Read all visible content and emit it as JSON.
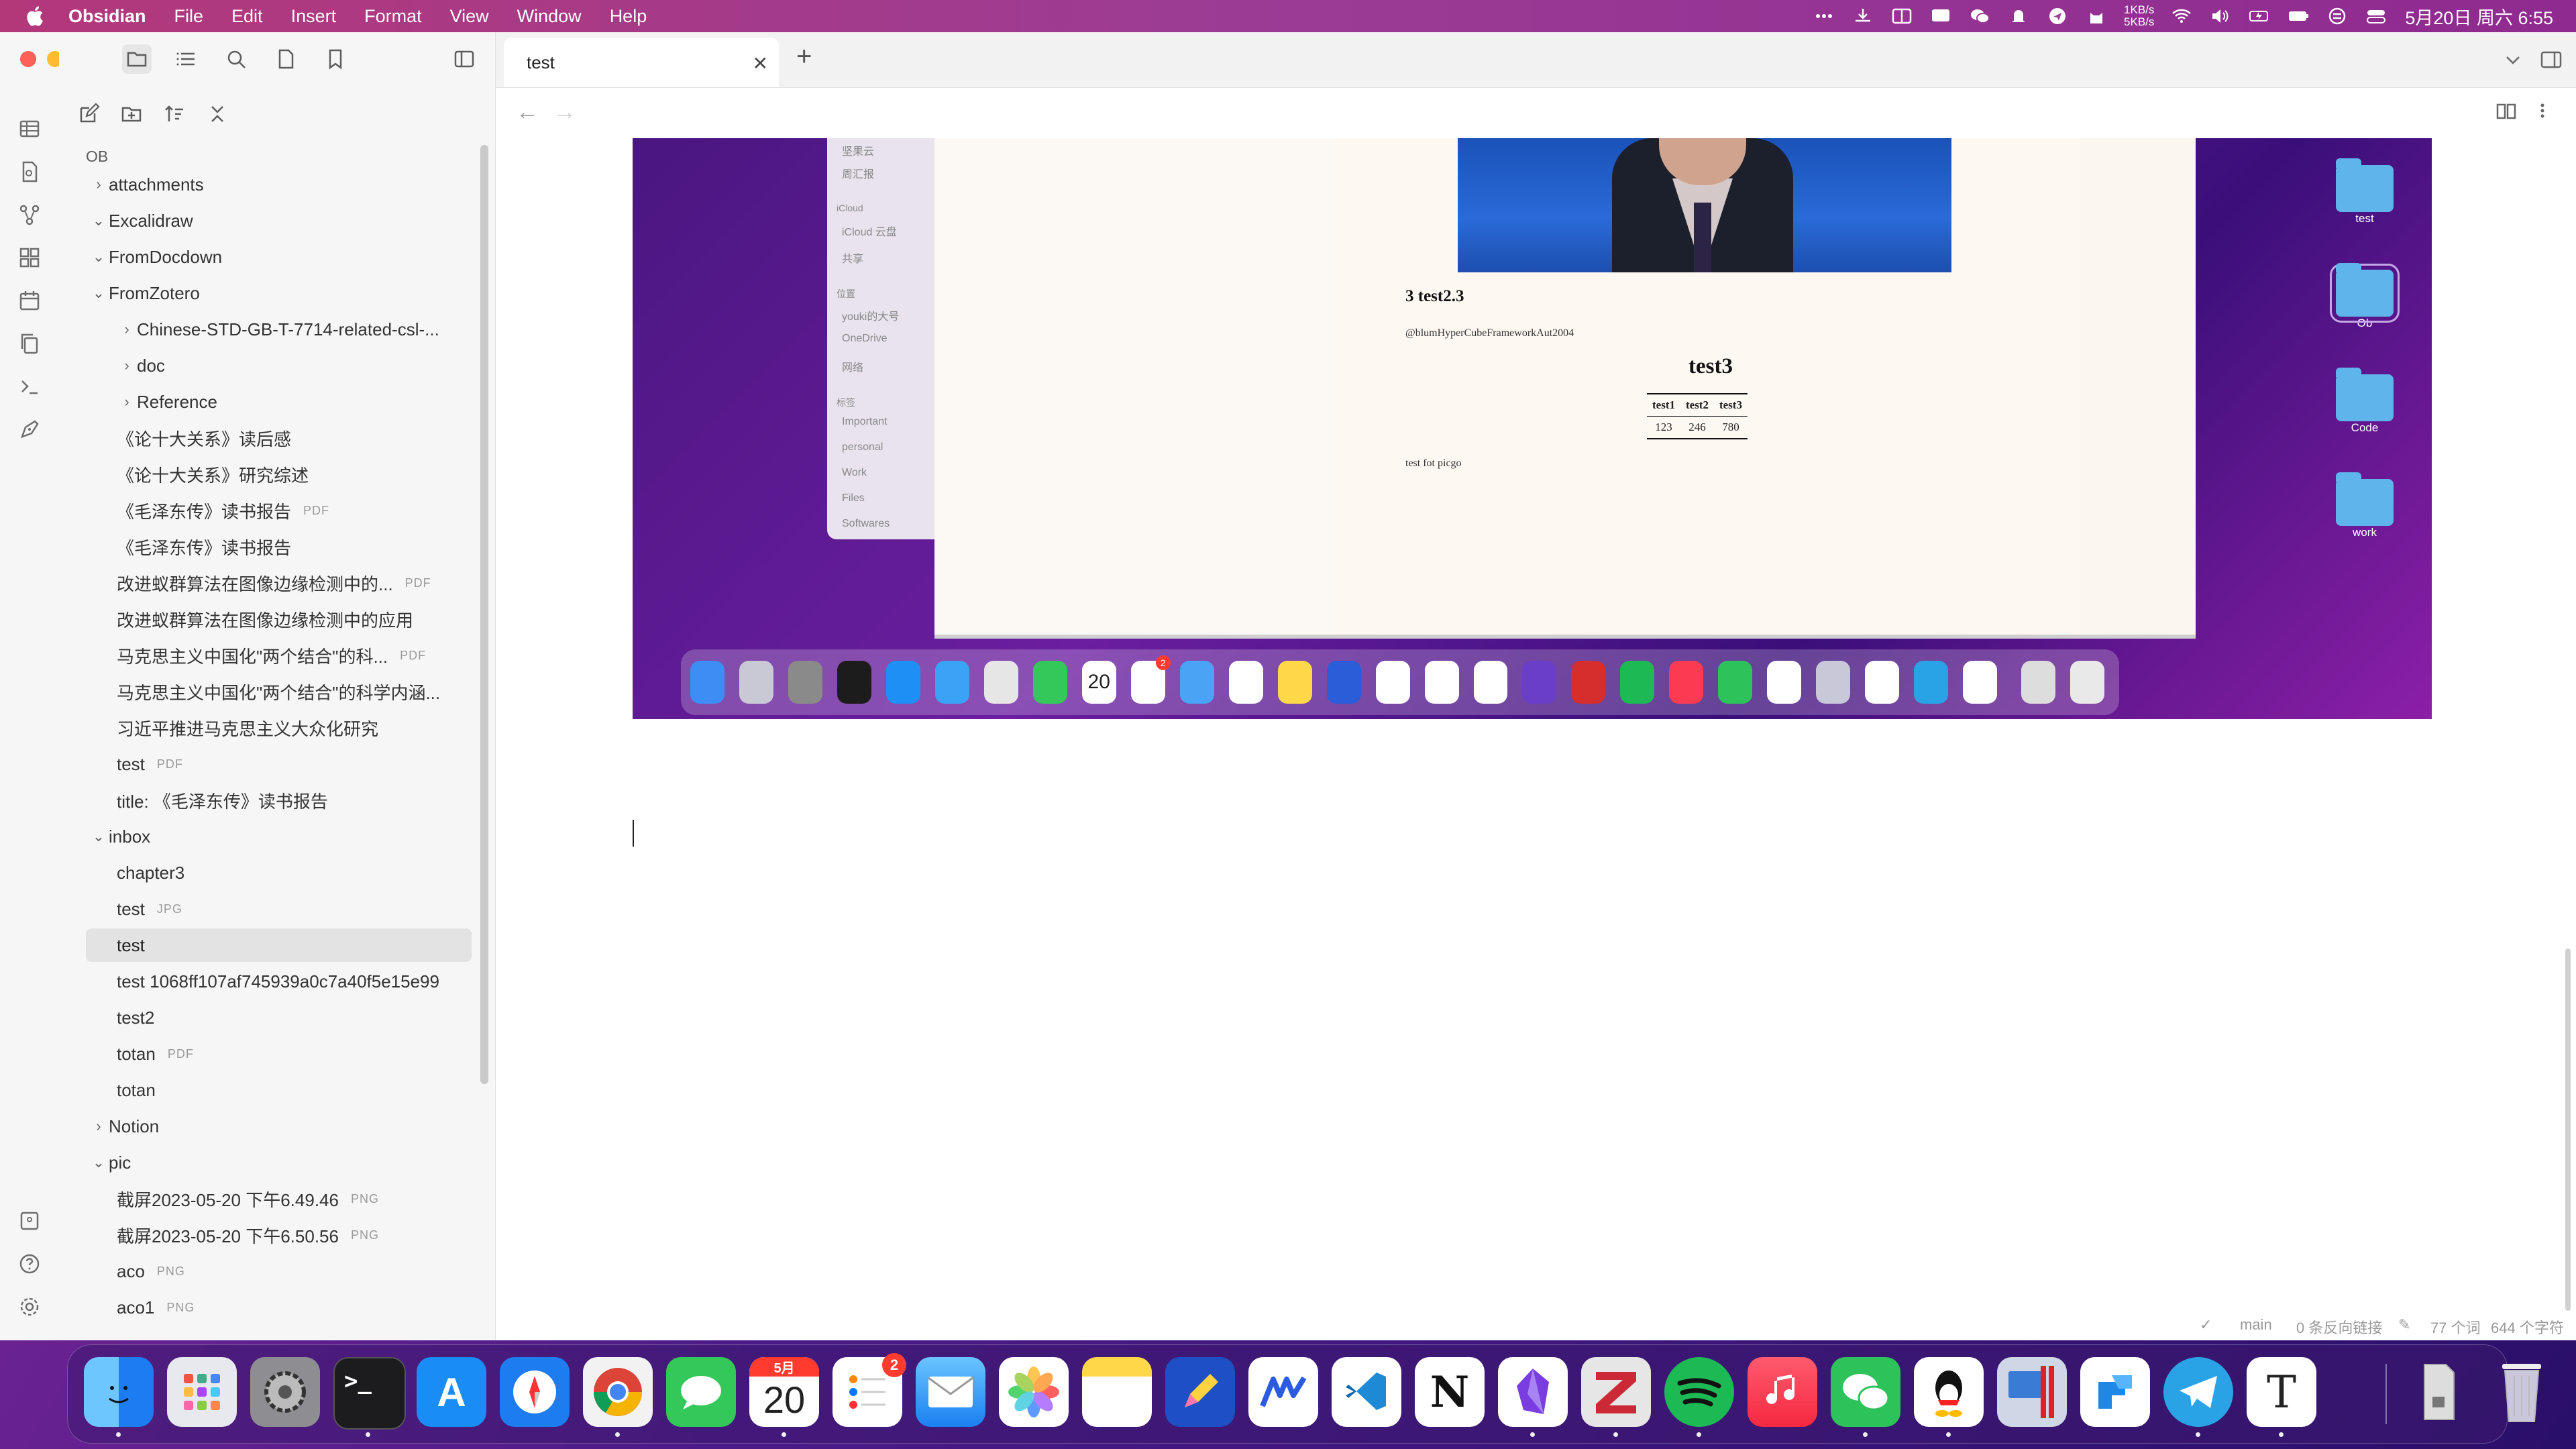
{
  "menubar": {
    "app_name": "Obsidian",
    "menus": [
      "File",
      "Edit",
      "Insert",
      "Format",
      "View",
      "Window",
      "Help"
    ],
    "net_up": "1KB/s",
    "net_down": "5KB/s",
    "clock": "5月20日 周六  6:55"
  },
  "sidebar": {
    "vault_name": "OB",
    "tree": [
      {
        "label": "attachments",
        "chev": "›",
        "depth": 0
      },
      {
        "label": "Excalidraw",
        "chev": "⌄",
        "depth": 0
      },
      {
        "label": "FromDocdown",
        "chev": "⌄",
        "depth": 0
      },
      {
        "label": "FromZotero",
        "chev": "⌄",
        "depth": 0
      },
      {
        "label": "Chinese-STD-GB-T-7714-related-csl-...",
        "chev": "›",
        "depth": 1
      },
      {
        "label": "doc",
        "chev": "›",
        "depth": 1
      },
      {
        "label": "Reference",
        "chev": "›",
        "depth": 1
      },
      {
        "label": "《论十大关系》读后感",
        "depth": 1
      },
      {
        "label": "《论十大关系》研究综述",
        "depth": 1
      },
      {
        "label": "《毛泽东传》读书报告",
        "ext": "PDF",
        "depth": 1
      },
      {
        "label": "《毛泽东传》读书报告",
        "depth": 1
      },
      {
        "label": "改进蚁群算法在图像边缘检测中的...",
        "ext": "PDF",
        "depth": 1
      },
      {
        "label": "改进蚁群算法在图像边缘检测中的应用",
        "depth": 1
      },
      {
        "label": "马克思主义中国化\"两个结合\"的科...",
        "ext": "PDF",
        "depth": 1
      },
      {
        "label": "马克思主义中国化\"两个结合\"的科学内涵...",
        "depth": 1
      },
      {
        "label": "习近平推进马克思主义大众化研究",
        "depth": 1
      },
      {
        "label": "test",
        "ext": "PDF",
        "depth": 1
      },
      {
        "label": "title: 《毛泽东传》读书报告",
        "depth": 1
      },
      {
        "label": "inbox",
        "chev": "⌄",
        "depth": 0
      },
      {
        "label": "chapter3",
        "depth": 1
      },
      {
        "label": "test",
        "ext": "JPG",
        "depth": 1
      },
      {
        "label": "test",
        "depth": 1,
        "selected": true
      },
      {
        "label": "test 1068ff107af745939a0c7a40f5e15e99",
        "depth": 1
      },
      {
        "label": "test2",
        "depth": 1
      },
      {
        "label": "totan",
        "ext": "PDF",
        "depth": 1
      },
      {
        "label": "totan",
        "depth": 1
      },
      {
        "label": "Notion",
        "chev": "›",
        "depth": 0
      },
      {
        "label": "pic",
        "chev": "⌄",
        "depth": 0
      },
      {
        "label": "截屏2023-05-20 下午6.49.46",
        "ext": "PNG",
        "depth": 1
      },
      {
        "label": "截屏2023-05-20 下午6.50.56",
        "ext": "PNG",
        "depth": 1
      },
      {
        "label": "aco",
        "ext": "PNG",
        "depth": 1
      },
      {
        "label": "aco1",
        "ext": "PNG",
        "depth": 1
      }
    ]
  },
  "tab": {
    "title": "test"
  },
  "embed": {
    "finder_sidebar": [
      "坚果云",
      "周汇报",
      "iCloud",
      "iCloud 云盘",
      "共享",
      "位置",
      "youki的大号",
      "OneDrive",
      "网络",
      "标签",
      "Important",
      "personal",
      "Work",
      "Files",
      "Softwares"
    ],
    "doc": {
      "section_heading": "3    test2.3",
      "citation": "@blumHyperCubeFrameworkAut2004",
      "heading": "test3",
      "table_headers": [
        "test1",
        "test2",
        "test3"
      ],
      "table_values": [
        "123",
        "246",
        "780"
      ],
      "note": "test fot picgo"
    },
    "desktop_folders": [
      "test",
      "Ob",
      "Code",
      "work"
    ],
    "mini_calendar_day": "20",
    "mini_badge": "2"
  },
  "statusbar": {
    "branch": "main",
    "backlinks": "0 条反向链接",
    "words": "77 个词",
    "chars": "644 个字符"
  },
  "dock": {
    "calendar_month": "5月",
    "calendar_day": "20",
    "reminders_badge": "2",
    "apps": [
      "Finder",
      "Launchpad",
      "System Settings",
      "Terminal",
      "App Store",
      "Safari",
      "Chrome",
      "Messages",
      "Calendar",
      "Reminders",
      "Mail",
      "Photos",
      "Notes",
      "Draw",
      "Wps",
      "VS Code",
      "Notion",
      "Obsidian",
      "Zotero",
      "Spotify",
      "Music",
      "WeChat",
      "QQ",
      "Parallels",
      "Flow",
      "Telegram",
      "Typora",
      "Archive",
      "Trash"
    ],
    "colors": {
      "accent": "#7a3ee0",
      "red": "#ff3b30"
    }
  }
}
